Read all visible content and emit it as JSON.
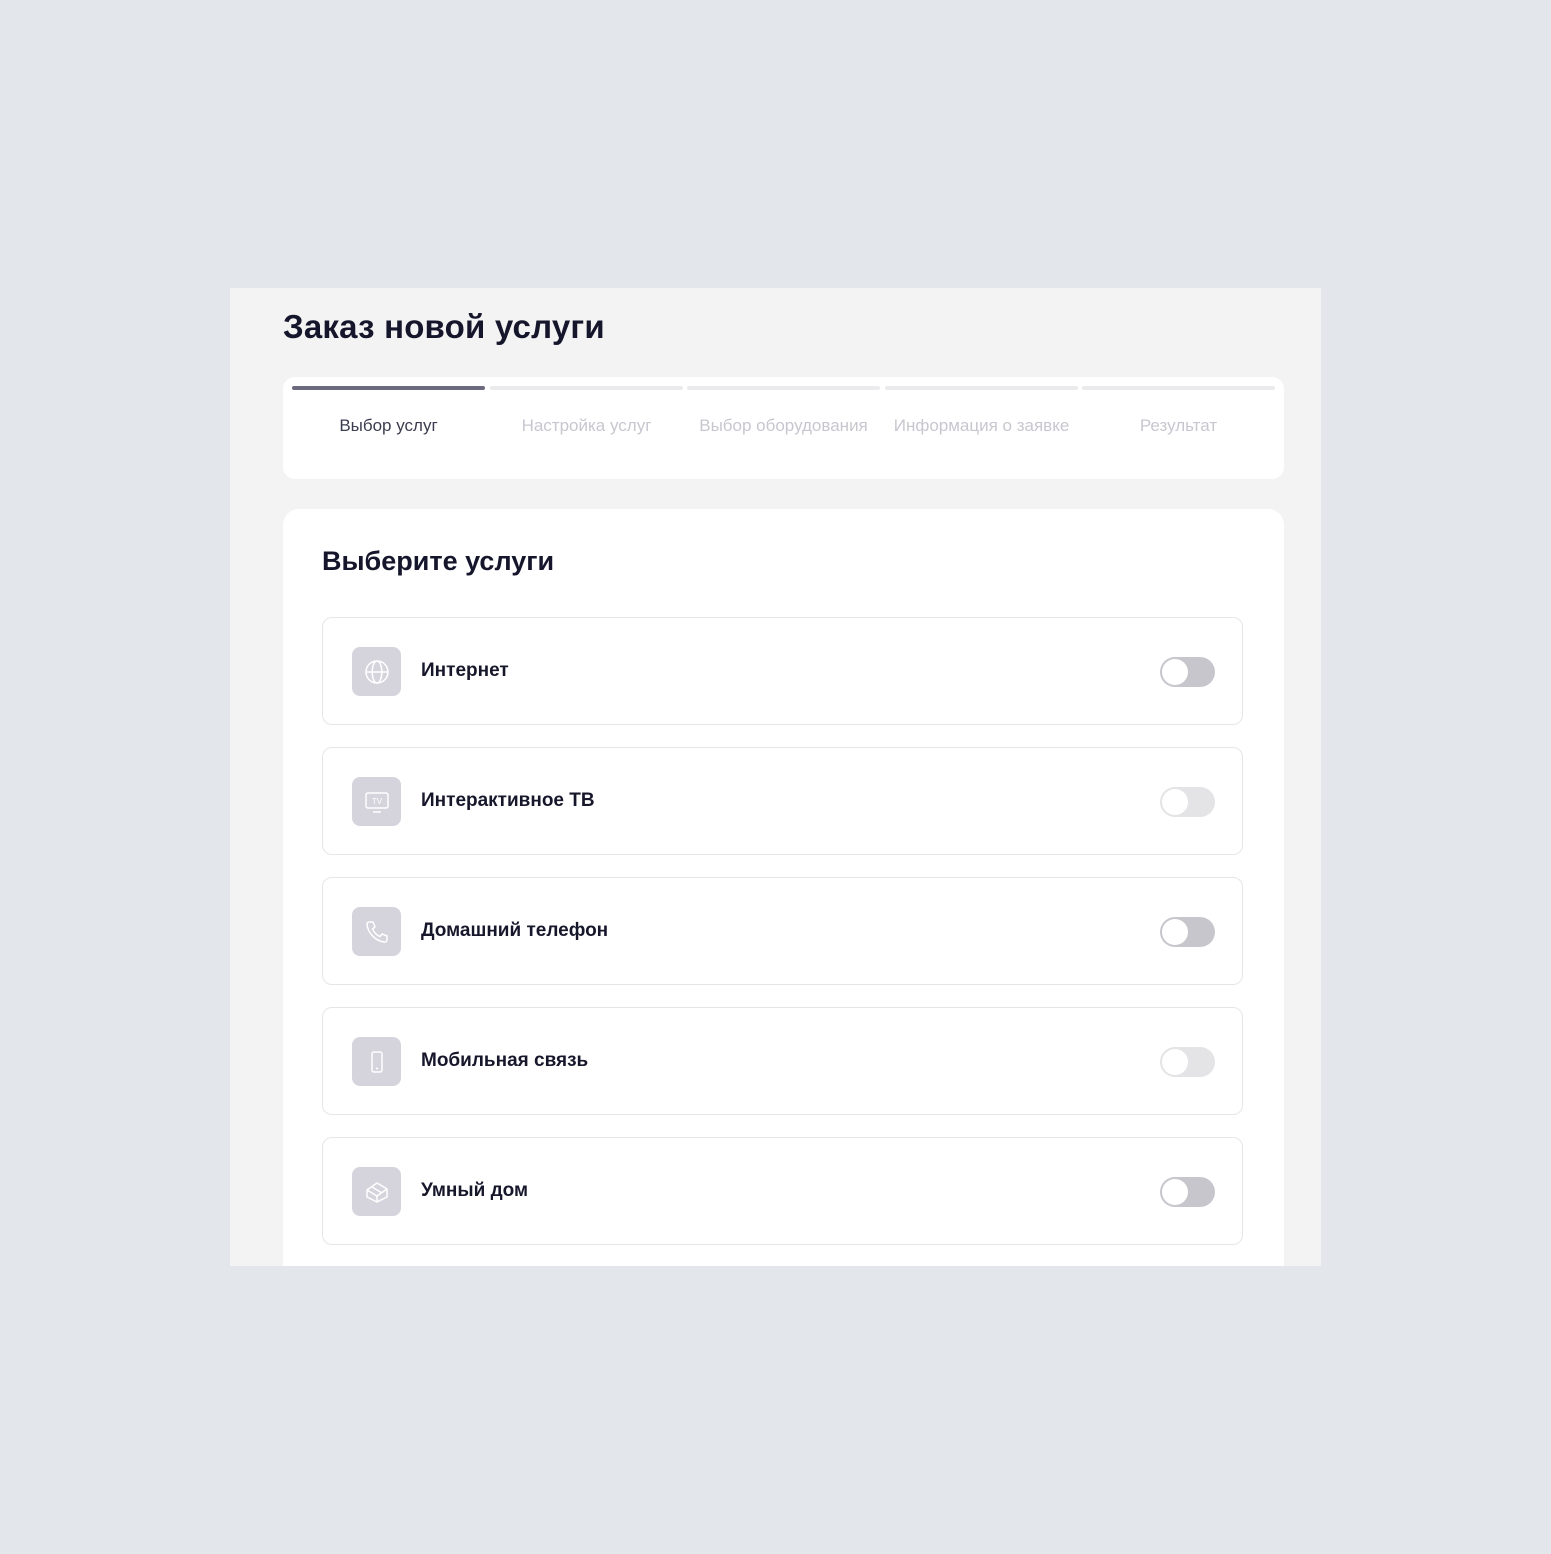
{
  "page": {
    "title": "Заказ новой услуги"
  },
  "stepper": {
    "steps": [
      {
        "label": "Выбор услуг",
        "state": "active"
      },
      {
        "label": "Настройка услуг",
        "state": "inactive"
      },
      {
        "label": "Выбор оборудования",
        "state": "inactive"
      },
      {
        "label": "Информация о заявке",
        "state": "inactive"
      },
      {
        "label": "Результат",
        "state": "inactive"
      }
    ]
  },
  "services": {
    "title": "Выберите услуги",
    "items": [
      {
        "label": "Интернет",
        "icon": "globe-icon",
        "toggle": "off",
        "enabled": true
      },
      {
        "label": "Интерактивное ТВ",
        "icon": "tv-icon",
        "icon_text": "TV",
        "toggle": "off",
        "enabled": false
      },
      {
        "label": "Домашний телефон",
        "icon": "phone-icon",
        "toggle": "off",
        "enabled": true
      },
      {
        "label": "Мобильная связь",
        "icon": "mobile-icon",
        "toggle": "off",
        "enabled": false
      },
      {
        "label": "Умный дом",
        "icon": "smart-home-icon",
        "toggle": "off",
        "enabled": true
      }
    ]
  },
  "colors": {
    "page_background": "#e3e7eb",
    "panel_background": "#f3f3f3",
    "card_background": "#ffffff",
    "step_active_bar": "#6b6a7f",
    "step_inactive_bar": "#ebebee",
    "icon_tile": "#d5d4dd",
    "toggle_off": "#c6c6cc",
    "toggle_disabled": "#e4e4e7"
  }
}
